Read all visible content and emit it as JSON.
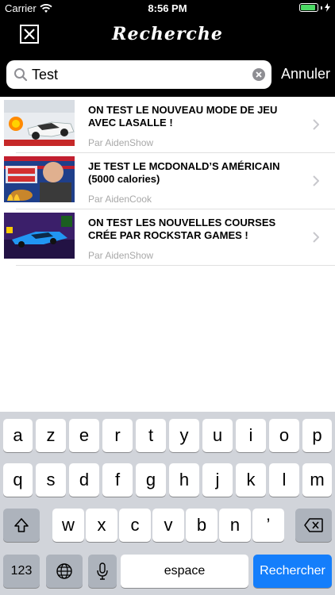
{
  "status_bar": {
    "carrier": "Carrier",
    "time": "8:56 PM",
    "wifi_icon": "wifi-icon",
    "battery_icon": "battery-icon",
    "charging_icon": "bolt-icon",
    "battery_level": 0.9,
    "battery_color": "#4cd964"
  },
  "nav": {
    "title": "Recherche",
    "close_icon": "close-icon"
  },
  "search": {
    "value": "Test",
    "cancel_label": "Annuler"
  },
  "results": [
    {
      "title": "ON TEST LE NOUVEAU MODE DE JEU AVEC LASALLE !",
      "author": "Par AidenShow"
    },
    {
      "title": "JE TEST LE MCDONALD’S AMÉRICAIN (5000 calories)",
      "author": "Par AidenCook"
    },
    {
      "title": "ON TEST LES NOUVELLES COURSES CRÉE PAR ROCKSTAR GAMES !",
      "author": "Par AidenShow"
    }
  ],
  "keyboard": {
    "row1": [
      "a",
      "z",
      "e",
      "r",
      "t",
      "y",
      "u",
      "i",
      "o",
      "p"
    ],
    "row2": [
      "q",
      "s",
      "d",
      "f",
      "g",
      "h",
      "j",
      "k",
      "l",
      "m"
    ],
    "row3": [
      "w",
      "x",
      "c",
      "v",
      "b",
      "n",
      "’"
    ],
    "numbers_label": "123",
    "space_label": "espace",
    "search_label": "Rechercher",
    "shift_icon": "shift-icon",
    "delete_icon": "delete-icon",
    "globe_icon": "globe-icon",
    "mic_icon": "microphone-icon",
    "accent_color": "#147efb"
  }
}
